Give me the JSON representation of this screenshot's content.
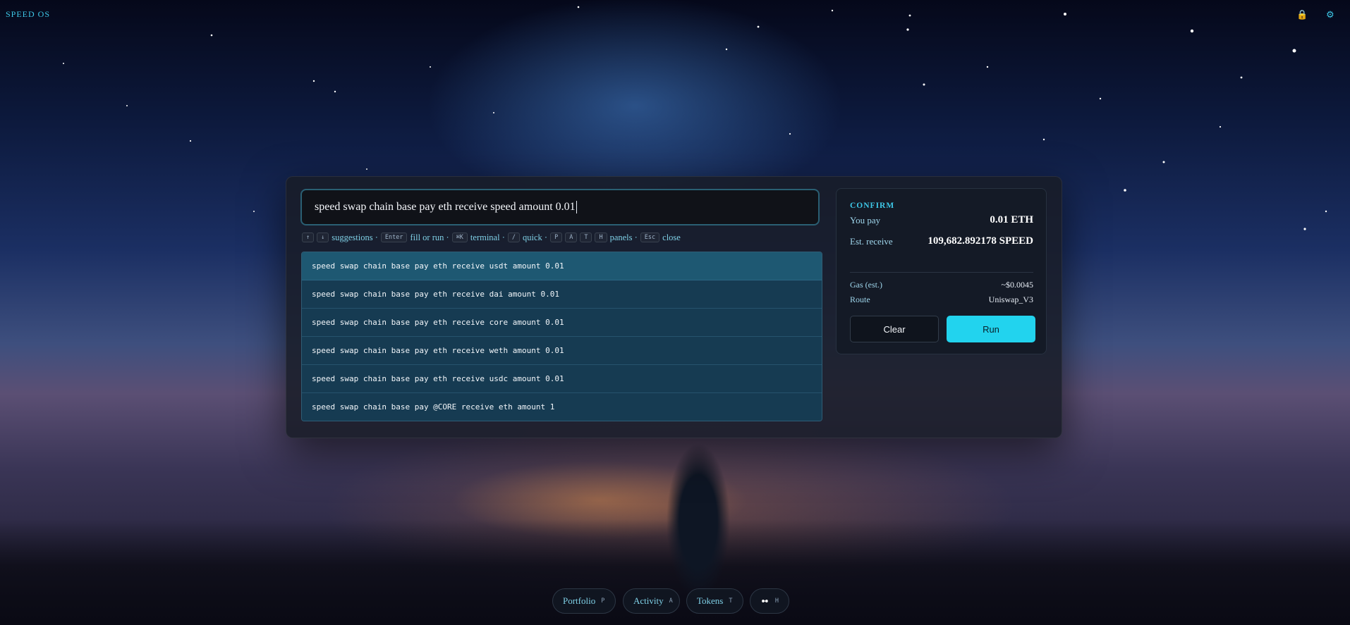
{
  "app": {
    "brand": "SPEED OS"
  },
  "topbar": {
    "lock_icon": "lock-icon",
    "settings_icon": "gear-icon"
  },
  "command": {
    "value": "speed swap chain base pay eth receive speed amount 0.01"
  },
  "hints": {
    "up_key": "↑",
    "down_key": "↓",
    "suggestions": "suggestions ·",
    "enter_key": "Enter",
    "fill_or_run": "fill or run ·",
    "terminal_key": "⌘K",
    "terminal": "terminal ·",
    "quick_key": "/",
    "quick": "quick ·",
    "p_key": "P",
    "a_key": "A",
    "t_key": "T",
    "h_key": "H",
    "panels": "panels ·",
    "esc_key": "Esc",
    "close": "close"
  },
  "suggestions": [
    "speed swap chain base pay eth receive usdt amount 0.01",
    "speed swap chain base pay eth receive dai amount 0.01",
    "speed swap chain base pay eth receive core amount 0.01",
    "speed swap chain base pay eth receive weth amount 0.01",
    "speed swap chain base pay eth receive usdc amount 0.01",
    "speed swap chain base pay @CORE receive eth amount 1"
  ],
  "confirm": {
    "title": "CONFIRM",
    "you_pay_label": "You pay",
    "you_pay_value": "0.01 ETH",
    "est_receive_label": "Est. receive",
    "est_receive_value": "109,682.892178 SPEED",
    "gas_label": "Gas (est.)",
    "gas_value": "~$0.0045",
    "route_label": "Route",
    "route_value": "Uniswap_V3",
    "clear_label": "Clear",
    "run_label": "Run"
  },
  "dock": {
    "portfolio": "Portfolio",
    "portfolio_key": "P",
    "activity": "Activity",
    "activity_key": "A",
    "tokens": "Tokens",
    "tokens_key": "T",
    "history_icon": "infinity-icon",
    "history_key": "H"
  },
  "colors": {
    "accent": "#22d3ee",
    "panel": "#181c26"
  }
}
